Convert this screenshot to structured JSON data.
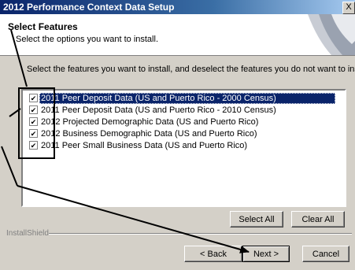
{
  "window": {
    "title": "2012 Performance Context Data Setup",
    "close_glyph": "X"
  },
  "header": {
    "title": "Select Features",
    "subtitle": "Select the options you want to install."
  },
  "instruction": "Select the features you want to install, and deselect the features you do not want to install.",
  "features": [
    {
      "label": "2011 Peer Deposit Data (US and Puerto Rico - 2000 Census)",
      "checked": true,
      "selected": true
    },
    {
      "label": "2011 Peer Deposit Data (US and Puerto Rico - 2010 Census)",
      "checked": true,
      "selected": false
    },
    {
      "label": "2012 Projected Demographic Data (US and Puerto Rico)",
      "checked": true,
      "selected": false
    },
    {
      "label": "2012 Business Demographic Data (US and Puerto Rico)",
      "checked": true,
      "selected": false
    },
    {
      "label": "2011 Peer Small Business Data (US and Puerto Rico)",
      "checked": true,
      "selected": false
    }
  ],
  "buttons": {
    "select_all": "Select All",
    "clear_all": "Clear All",
    "back": "< Back",
    "next": "Next >",
    "cancel": "Cancel"
  },
  "footer": {
    "brand": "InstallShield"
  },
  "colors": {
    "titlebar": "#0a246a",
    "selection": "#0a246a",
    "annotation": "#000000"
  }
}
